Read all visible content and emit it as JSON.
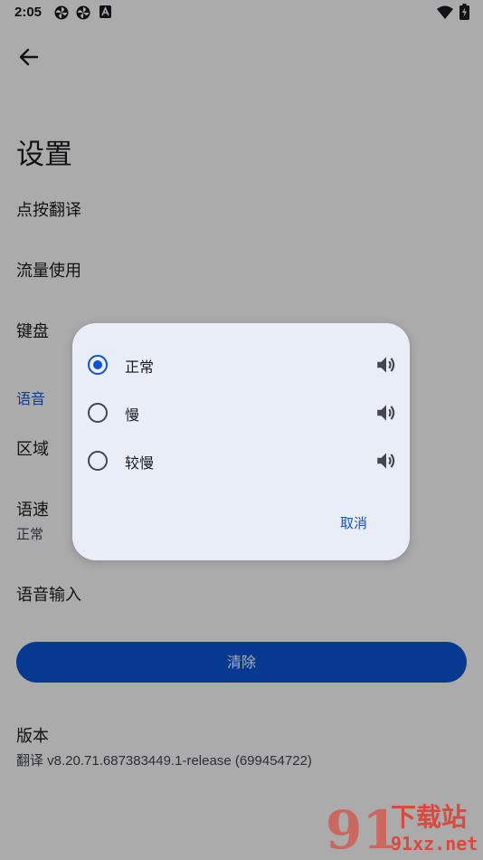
{
  "status_bar": {
    "time": "2:05",
    "icons": [
      "pinwheel-icon",
      "pinwheel-icon",
      "a-letter-icon",
      "wifi-icon",
      "battery-charging-icon"
    ]
  },
  "colors": {
    "accent": "#1252d2",
    "button": "#0d56d9",
    "dialog_bg": "#e8edf8",
    "watermark": "#e03a2e"
  },
  "header": {
    "back_icon": "arrow-back-icon",
    "title": "设置"
  },
  "settings": {
    "tap_translate": "点按翻译",
    "data_usage": "流量使用",
    "keyboard": "键盘",
    "voice_section": "语音",
    "region": "区域",
    "speech_rate": {
      "title": "语速",
      "value": "正常"
    },
    "voice_input": "语音输入",
    "clear_label": "清除",
    "version": {
      "title": "版本",
      "value": "翻译 v8.20.71.687383449.1-release (699454722)"
    }
  },
  "dialog": {
    "options": [
      {
        "label": "正常",
        "selected": true,
        "icon": "speaker-icon"
      },
      {
        "label": "慢",
        "selected": false,
        "icon": "speaker-icon"
      },
      {
        "label": "较慢",
        "selected": false,
        "icon": "speaker-icon"
      }
    ],
    "cancel_label": "取消"
  },
  "watermark": {
    "mark": "91",
    "title": "下载站",
    "url": "91xz.net"
  }
}
